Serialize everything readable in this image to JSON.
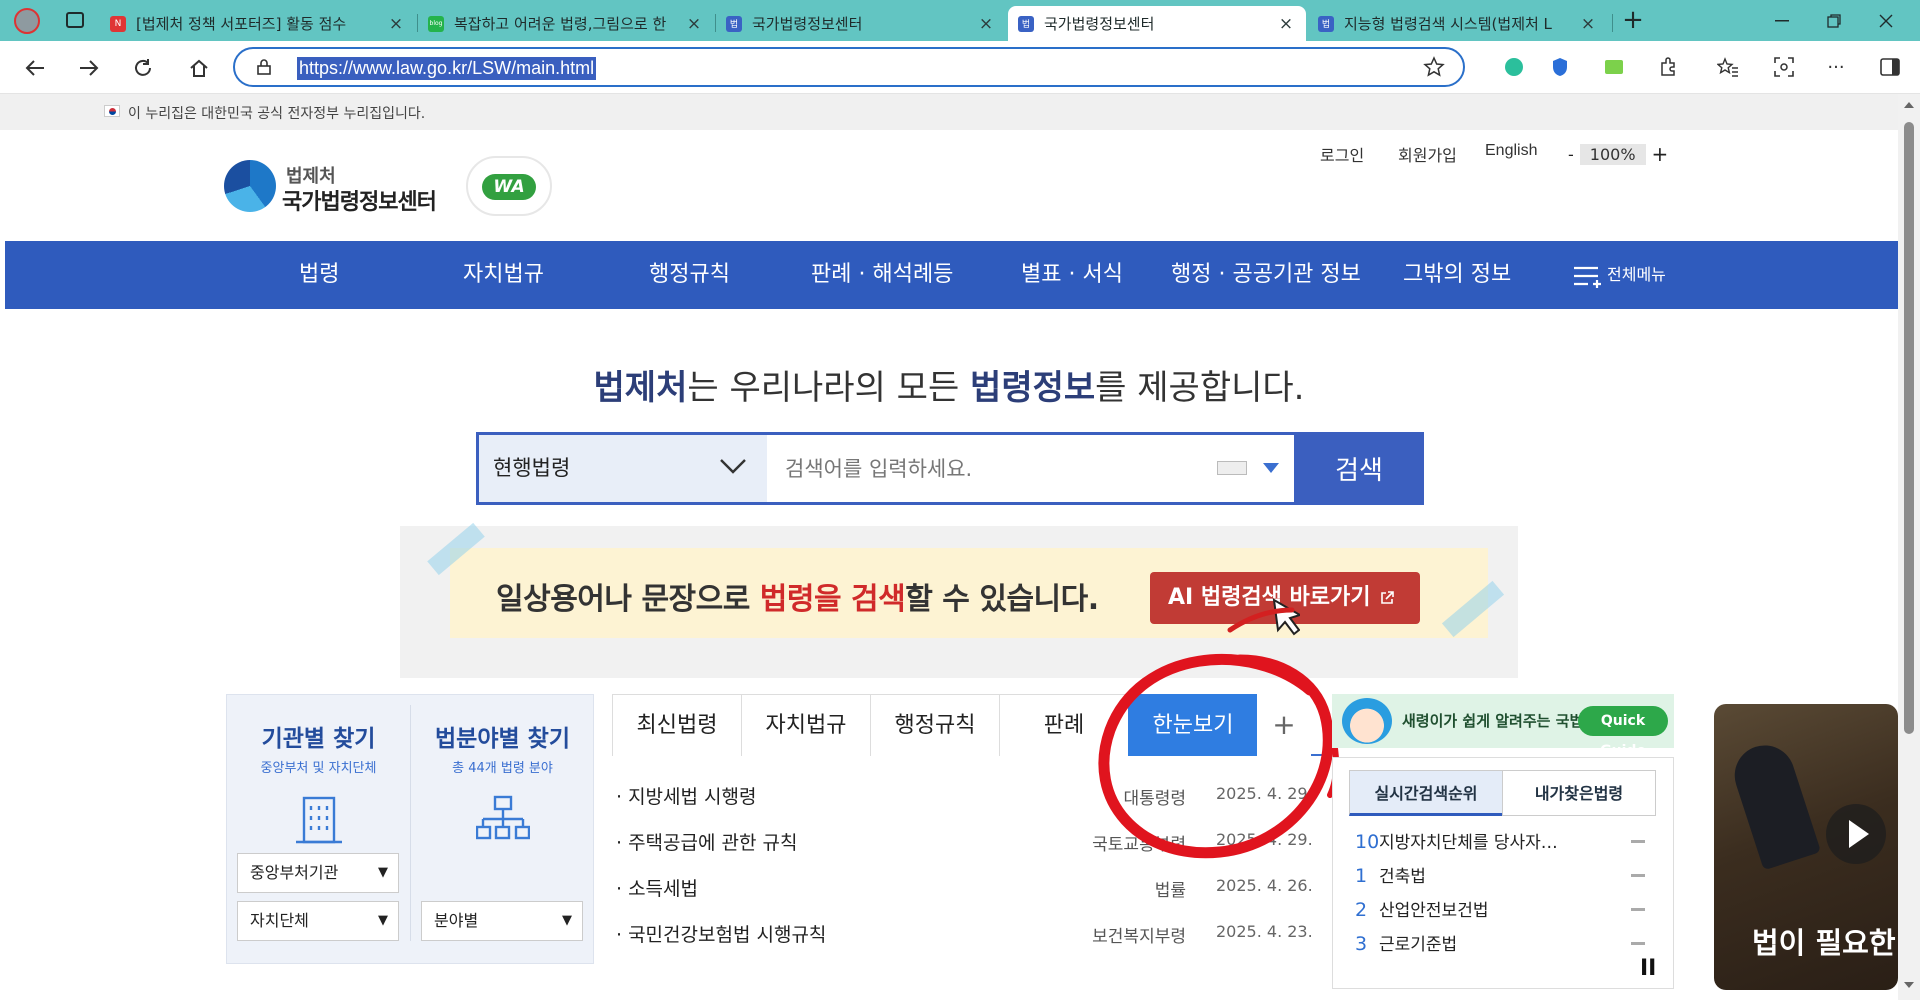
{
  "browser": {
    "tabs": [
      {
        "title": "[법제처 정책 서포터즈] 활동 점수",
        "favicon": "N"
      },
      {
        "title": "복잡하고 어려운 법령,그림으로 한",
        "favicon": "blog"
      },
      {
        "title": "국가법령정보센터",
        "favicon": "법"
      },
      {
        "title": "국가법령정보센터",
        "favicon": "법"
      },
      {
        "title": "지능형 법령검색 시스템(법제처 L",
        "favicon": "법"
      }
    ],
    "url": "https://www.law.go.kr/LSW/main.html"
  },
  "gov_notice": "이 누리집은 대한민국 공식 전자정부 누리집입니다.",
  "header": {
    "logo_line1": "법제처",
    "logo_line2": "국가법령정보센터",
    "wa_badge": "WA",
    "util_links": [
      "로그인",
      "회원가입",
      "English"
    ],
    "zoom_minus": "-",
    "zoom_value": "100%",
    "zoom_plus": "+"
  },
  "main_nav": {
    "items": [
      "법령",
      "자치법규",
      "행정규칙",
      "판례 · 해석례등",
      "별표 · 서식",
      "행정 · 공공기관 정보",
      "그밖의 정보"
    ],
    "all_menu": "전체메뉴"
  },
  "hero": {
    "headline_bold1": "법제처",
    "headline_mid": "는 우리나라의 모든 ",
    "headline_bold2": "법령정보",
    "headline_end": "를 제공합니다.",
    "scope_selected": "현행법령",
    "search_placeholder": "검색어를 입력하세요.",
    "search_button": "검색"
  },
  "banner": {
    "text_pre": "일상용어나 문장으로 ",
    "text_red": "법령을 검색",
    "text_post": "할 수 있습니다.",
    "button": "AI 법령검색 바로가기"
  },
  "finder": {
    "by_agency_title": "기관별 찾기",
    "by_agency_sub": "중앙부처 및 자치단체",
    "by_field_title": "법분야별 찾기",
    "by_field_sub": "총 44개 법령 분야",
    "agency_select1": "중앙부처기관",
    "agency_select2": "자치단체",
    "field_select": "분야별"
  },
  "law_tabs": {
    "tabs": [
      "최신법령",
      "자치법규",
      "행정규칙",
      "판례",
      "한눈보기"
    ],
    "active": "한눈보기",
    "plus": "+",
    "rows": [
      {
        "name": "· 지방세법 시행령",
        "category": "대통령령",
        "date": "2025. 4. 29."
      },
      {
        "name": "· 주택공급에 관한 규칙",
        "category": "국토교통부령",
        "date": "2025. 4. 29."
      },
      {
        "name": "· 소득세법",
        "category": "법률",
        "date": "2025. 4. 26."
      },
      {
        "name": "· 국민건강보험법 시행규칙",
        "category": "보건복지부령",
        "date": "2025. 4. 23."
      }
    ]
  },
  "quick_guide": {
    "text": "새령이가 쉽게 알려주는 국법",
    "button": "Quick Guide"
  },
  "ranking": {
    "tab_realtime": "실시간검색순위",
    "tab_mine": "내가찾은법령",
    "items": [
      {
        "rank": "10",
        "name": "지방자치단체를 당사자…"
      },
      {
        "rank": "1",
        "name": "건축법"
      },
      {
        "rank": "2",
        "name": "산업안전보건법"
      },
      {
        "rank": "3",
        "name": "근로기준법"
      }
    ],
    "pause": "II"
  },
  "video": {
    "caption": "법이 필요한"
  },
  "colors": {
    "nav_blue": "#2f5bbd",
    "tab_active": "#2f7de1",
    "annotation_red": "#e0141e",
    "chrome_teal": "#62c5c2"
  }
}
